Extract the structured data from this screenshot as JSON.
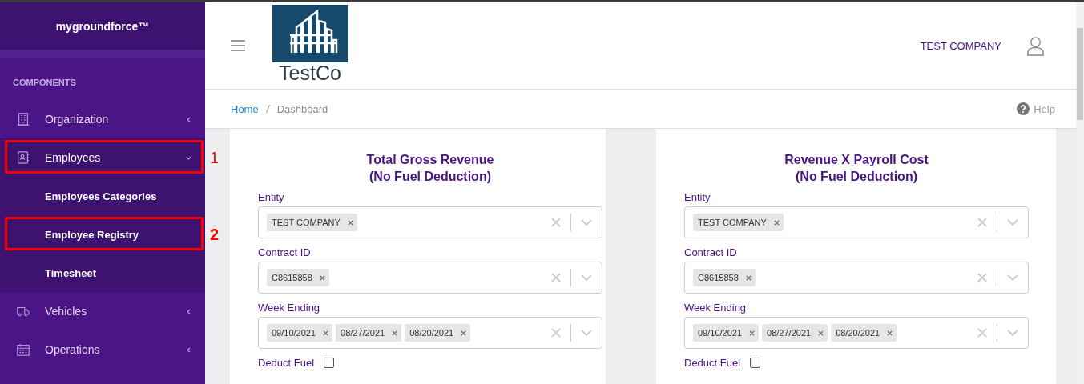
{
  "brand": "mygroundforce™",
  "sidebar": {
    "section_title": "COMPONENTS",
    "items": [
      {
        "label": "Organization",
        "expanded": false
      },
      {
        "label": "Employees",
        "expanded": true,
        "annotation": "1",
        "children": [
          {
            "label": "Employees Categories"
          },
          {
            "label": "Employee Registry",
            "annotation": "2"
          },
          {
            "label": "Timesheet"
          }
        ]
      },
      {
        "label": "Vehicles",
        "expanded": false
      },
      {
        "label": "Operations",
        "expanded": false
      }
    ]
  },
  "header": {
    "logo_text": "TestCo",
    "company": "TEST COMPANY"
  },
  "breadcrumbs": [
    {
      "label": "Home",
      "kind": "link"
    },
    {
      "label": "Dashboard",
      "kind": "current"
    }
  ],
  "help": "Help",
  "cards": [
    {
      "title": "Total Gross Revenue\n(No Fuel Deduction)",
      "fields": [
        {
          "label": "Entity",
          "chips": [
            "TEST COMPANY"
          ]
        },
        {
          "label": "Contract ID",
          "chips": [
            "C8615858"
          ]
        },
        {
          "label": "Week Ending",
          "chips": [
            "09/10/2021",
            "08/27/2021",
            "08/20/2021"
          ]
        }
      ],
      "checkbox": {
        "label": "Deduct Fuel",
        "checked": false
      }
    },
    {
      "title": "Revenue X Payroll Cost\n(No Fuel Deduction)",
      "fields": [
        {
          "label": "Entity",
          "chips": [
            "TEST COMPANY"
          ]
        },
        {
          "label": "Contract ID",
          "chips": [
            "C8615858"
          ]
        },
        {
          "label": "Week Ending",
          "chips": [
            "09/10/2021",
            "08/27/2021",
            "08/20/2021"
          ]
        }
      ],
      "checkbox": {
        "label": "Deduct Fuel",
        "checked": false
      }
    }
  ]
}
